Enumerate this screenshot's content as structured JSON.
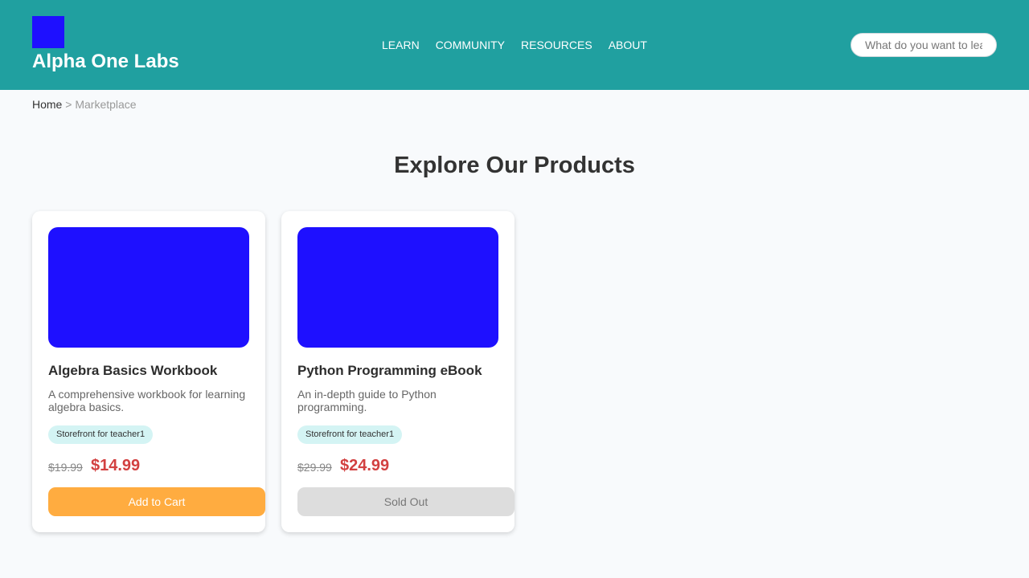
{
  "header": {
    "brand": "Alpha One Labs",
    "nav": [
      "LEARN",
      "COMMUNITY",
      "RESOURCES",
      "ABOUT"
    ],
    "search_placeholder": "What do you want to learn?"
  },
  "breadcrumb": {
    "home": "Home",
    "separator": ">",
    "current": "Marketplace"
  },
  "page_title": "Explore Our Products",
  "products": [
    {
      "title": "Algebra Basics Workbook",
      "description": "A comprehensive workbook for learning algebra basics.",
      "store": "Storefront for teacher1",
      "old_price": "$19.99",
      "price": "$14.99",
      "action_label": "Add to Cart"
    },
    {
      "title": "Python Programming eBook",
      "description": "An in-depth guide to Python programming.",
      "store": "Storefront for teacher1",
      "old_price": "$29.99",
      "price": "$24.99",
      "action_label": "Sold Out"
    }
  ],
  "colors": {
    "header": "#20a0a0",
    "logo": "#1e10ff",
    "product_image": "#1e10ff",
    "price": "#d24040",
    "add_to_cart": "#ffac40",
    "sold_out": "#dddddd",
    "store_badge": "#d4f4f4"
  }
}
